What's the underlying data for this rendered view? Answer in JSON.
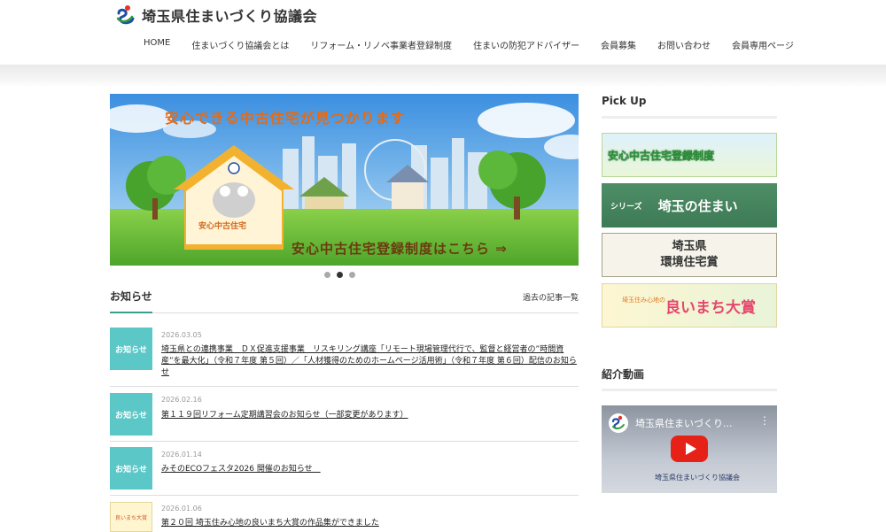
{
  "site": {
    "title": "埼玉県住まいづくり協議会",
    "colors": {
      "accent": "#3aa08c",
      "badge": "#5cc7c7",
      "logo_blue": "#1f4ea1",
      "logo_green": "#2e9d3d",
      "logo_red": "#e5332a"
    }
  },
  "nav": {
    "items": [
      "HOME",
      "住まいづくり協議会とは",
      "リフォーム・リノベ事業者登録制度",
      "住まいの防犯アドバイザー",
      "会員募集",
      "お問い合わせ",
      "会員専用ページ"
    ]
  },
  "hero": {
    "headline": "安心できる中古住宅が見つかります",
    "house_label": "安心中古住宅",
    "cta": "安心中古住宅登録制度はこちら ⇒",
    "slide_count": 3,
    "active_slide": 2
  },
  "news": {
    "title": "お知らせ",
    "archive_link": "過去の記事一覧",
    "items": [
      {
        "badge": "お知らせ",
        "date": "2026.03.05",
        "text": "埼玉県との連携事業　ＤＸ促進支援事業　リスキリング講座「リモート現場管理代行で、監督と経営者の”時間資産”を最大化」（令和７年度 第５回）／「人材獲得のためのホームページ活用術」（令和７年度 第６回）配信のお知らせ"
      },
      {
        "badge": "お知らせ",
        "date": "2026.02.16",
        "text": "第１１９回リフォーム定期講習会のお知らせ（一部変更があります）"
      },
      {
        "badge": "お知らせ",
        "date": "2026.01.14",
        "text": "みそのECOフェスタ2026 開催のお知らせ　"
      },
      {
        "thumb": "良いまち大賞",
        "date": "2026.01.06",
        "text": "第２０回 埼玉住み心地の良いまち大賞の作品集ができました"
      }
    ]
  },
  "sidebar": {
    "pickup_title": "Pick Up",
    "banners": [
      {
        "text": "安心中古住宅登録制度"
      },
      {
        "small": "シリーズ",
        "big": "埼玉の住まい"
      },
      {
        "line1": "埼玉県",
        "line2": "環境住宅賞"
      },
      {
        "small": "埼玉住み心地の",
        "big": "良いまち大賞"
      }
    ],
    "video_title": "紹介動画",
    "video": {
      "title": "埼玉県住まいづくり...",
      "caption": "埼玉県住まいづくり協議会"
    }
  }
}
